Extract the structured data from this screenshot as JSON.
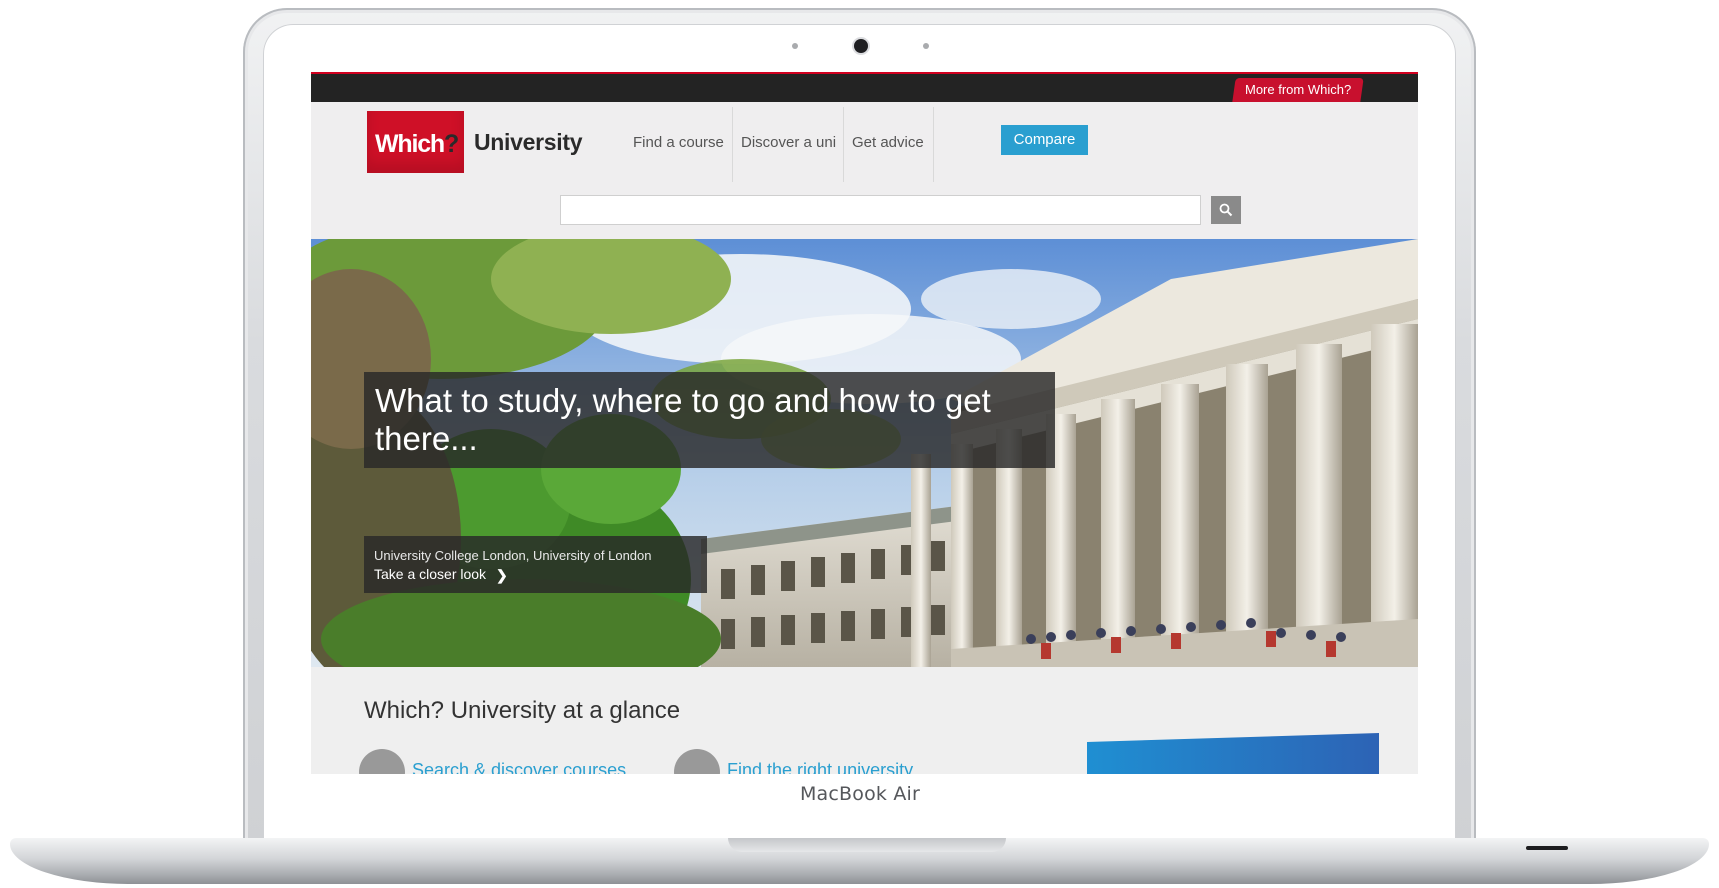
{
  "device": {
    "label": "MacBook Air"
  },
  "topbar": {
    "more_from": "More from Which?"
  },
  "header": {
    "logo_text_main": "Which",
    "logo_text_q": "?",
    "site_name": "University",
    "nav": [
      {
        "label": "Find a course"
      },
      {
        "label": "Discover a uni"
      },
      {
        "label": "Get advice"
      }
    ],
    "compare_label": "Compare"
  },
  "search": {
    "value": "",
    "placeholder": "",
    "icon": "search-icon"
  },
  "hero": {
    "headline": "What to study, where to go and how to get there...",
    "caption": "University College London, University of London",
    "caption_link": "Take a closer look",
    "caption_link_icon": "chevron-right-icon"
  },
  "glance": {
    "title": "Which? University at a glance",
    "links": [
      {
        "label": "Search & discover courses",
        "icon": "search-icon"
      },
      {
        "label": "Find the right university",
        "icon": "compass-icon"
      }
    ]
  },
  "colors": {
    "brand_red": "#cf1027",
    "accent_blue": "#2a9fd0",
    "topbar": "#232323"
  }
}
